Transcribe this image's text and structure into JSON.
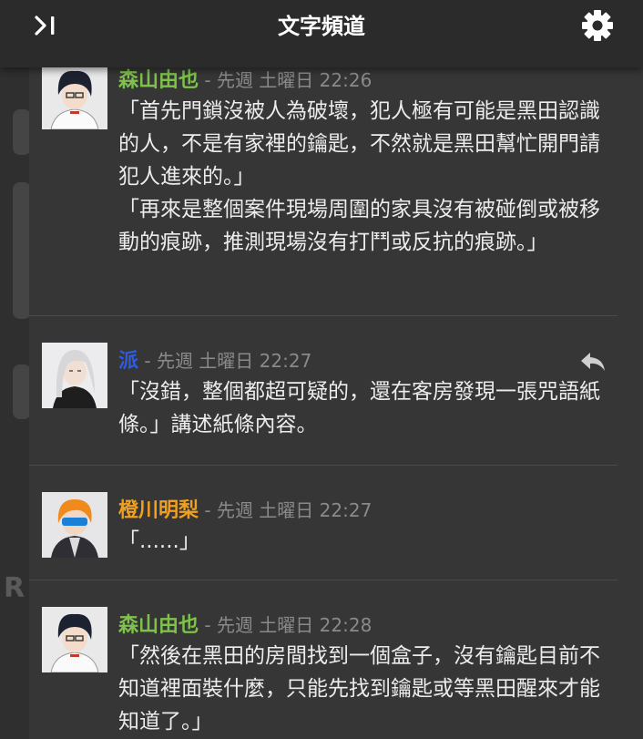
{
  "header": {
    "title": "文字頻道",
    "collapse_icon": "collapse-panel-icon",
    "settings_icon": "gear-icon"
  },
  "background": {
    "letter": "R"
  },
  "colors": {
    "green_name": "#7ec24a",
    "blue_name": "#2f5be0",
    "orange_name": "#f0a020",
    "timestamp": "#8a8a8a",
    "text": "#ececec"
  },
  "messages": [
    {
      "author": "森山由也",
      "timestamp": "- 先週 土曜日 22:26",
      "lines": [
        "「首先門鎖沒被人為破壞，犯人極有可能是黑田認識的人，不是有家裡的鑰匙，不然就是黑田幫忙開門請犯人進來的。」",
        "「再來是整個案件現場周圍的家具沒有被碰倒或被移動的痕跡，推測現場沒有打鬥或反抗的痕跡。」"
      ]
    },
    {
      "author": "派",
      "timestamp": "- 先週 土曜日 22:27",
      "lines": [
        "「沒錯，整個都超可疑的，還在客房發現一張咒語紙條。」講述紙條內容。"
      ]
    },
    {
      "author": "橙川明梨",
      "timestamp": "- 先週 土曜日 22:27",
      "lines": [
        "「......」"
      ]
    },
    {
      "author": "森山由也",
      "timestamp": "- 先週 土曜日 22:28",
      "lines": [
        "「然後在黑田的房間找到一個盒子，沒有鑰匙目前不知道裡面裝什麼，只能先找到鑰匙或等黑田醒來才能知道了。」"
      ]
    }
  ]
}
